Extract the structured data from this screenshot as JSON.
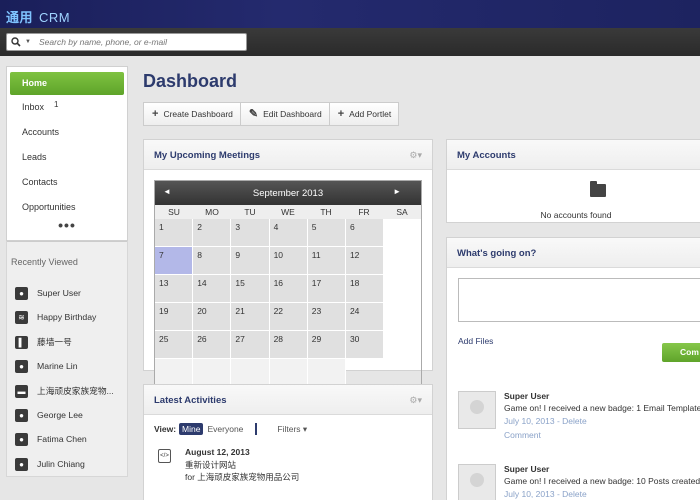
{
  "app": {
    "logo": "通用",
    "name": "CRM"
  },
  "search": {
    "placeholder": "Search by name, phone, or e-mail",
    "caret": "▼"
  },
  "nav": {
    "items": [
      {
        "label": "Home",
        "active": true
      },
      {
        "label": "Inbox",
        "badge": "1"
      },
      {
        "label": "Accounts"
      },
      {
        "label": "Leads"
      },
      {
        "label": "Contacts"
      },
      {
        "label": "Opportunities"
      }
    ],
    "more": "•••"
  },
  "recent": {
    "title": "Recently Viewed",
    "items": [
      {
        "label": "Super User",
        "icon": "user-icon"
      },
      {
        "label": "Happy Birthday",
        "icon": "layers-icon"
      },
      {
        "label": "藤墙一号",
        "icon": "book-icon"
      },
      {
        "label": "Marine Lin",
        "icon": "user-icon"
      },
      {
        "label": "上海顽皮家族宠物...",
        "icon": "folder-icon"
      },
      {
        "label": "George Lee",
        "icon": "user-icon"
      },
      {
        "label": "Fatima Chen",
        "icon": "user-icon"
      },
      {
        "label": "Julin Chiang",
        "icon": "user-icon"
      }
    ]
  },
  "dashboard": {
    "title": "Dashboard",
    "toolbar": [
      {
        "label": "Create Dashboard",
        "icon": "plus-icon"
      },
      {
        "label": "Edit Dashboard",
        "icon": "pencil-icon"
      },
      {
        "label": "Add Portlet",
        "icon": "plus-icon"
      }
    ]
  },
  "meetings": {
    "title": "My Upcoming Meetings",
    "gear": "⚙▾",
    "calendar": {
      "month": "September 2013",
      "prev": "◄",
      "next": "►",
      "dows": [
        "SU",
        "MO",
        "TU",
        "WE",
        "TH",
        "FR",
        "SA"
      ],
      "days": [
        "1",
        "2",
        "3",
        "4",
        "5",
        "6",
        "7",
        "8",
        "9",
        "10",
        "11",
        "12",
        "13",
        "14",
        "15",
        "16",
        "17",
        "18",
        "19",
        "20",
        "21",
        "22",
        "23",
        "24",
        "25",
        "26",
        "27",
        "28",
        "29",
        "30",
        "",
        "",
        "",
        "",
        ""
      ],
      "today": "7"
    }
  },
  "activities": {
    "title": "Latest Activities",
    "view_label": "View:",
    "mine": "Mine",
    "everyone": "Everyone",
    "filters": "Filters ▾",
    "items": [
      {
        "date": "August 12, 2013",
        "line1": "重新设计网站",
        "line2": "for 上海顽皮家族宠物用品公司"
      }
    ]
  },
  "accounts": {
    "title": "My Accounts",
    "empty": "No accounts found"
  },
  "going": {
    "title": "What's going on?",
    "add_files": "Add Files",
    "comment_btn": "Com",
    "posts": [
      {
        "name": "Super User",
        "text": "Game on! I received a new badge: 1 Email Template",
        "date": "July 10, 2013",
        "action": "Delete",
        "comment": "Comment"
      },
      {
        "name": "Super User",
        "text": "Game on! I received a new badge: 10 Posts created",
        "date": "July 10, 2013",
        "action": "Delete"
      }
    ]
  },
  "colors": {
    "accent_green": "#6ab234",
    "title_navy": "#2d3b6d",
    "topbar": "#1f2563",
    "today": "#b3b8e8"
  }
}
